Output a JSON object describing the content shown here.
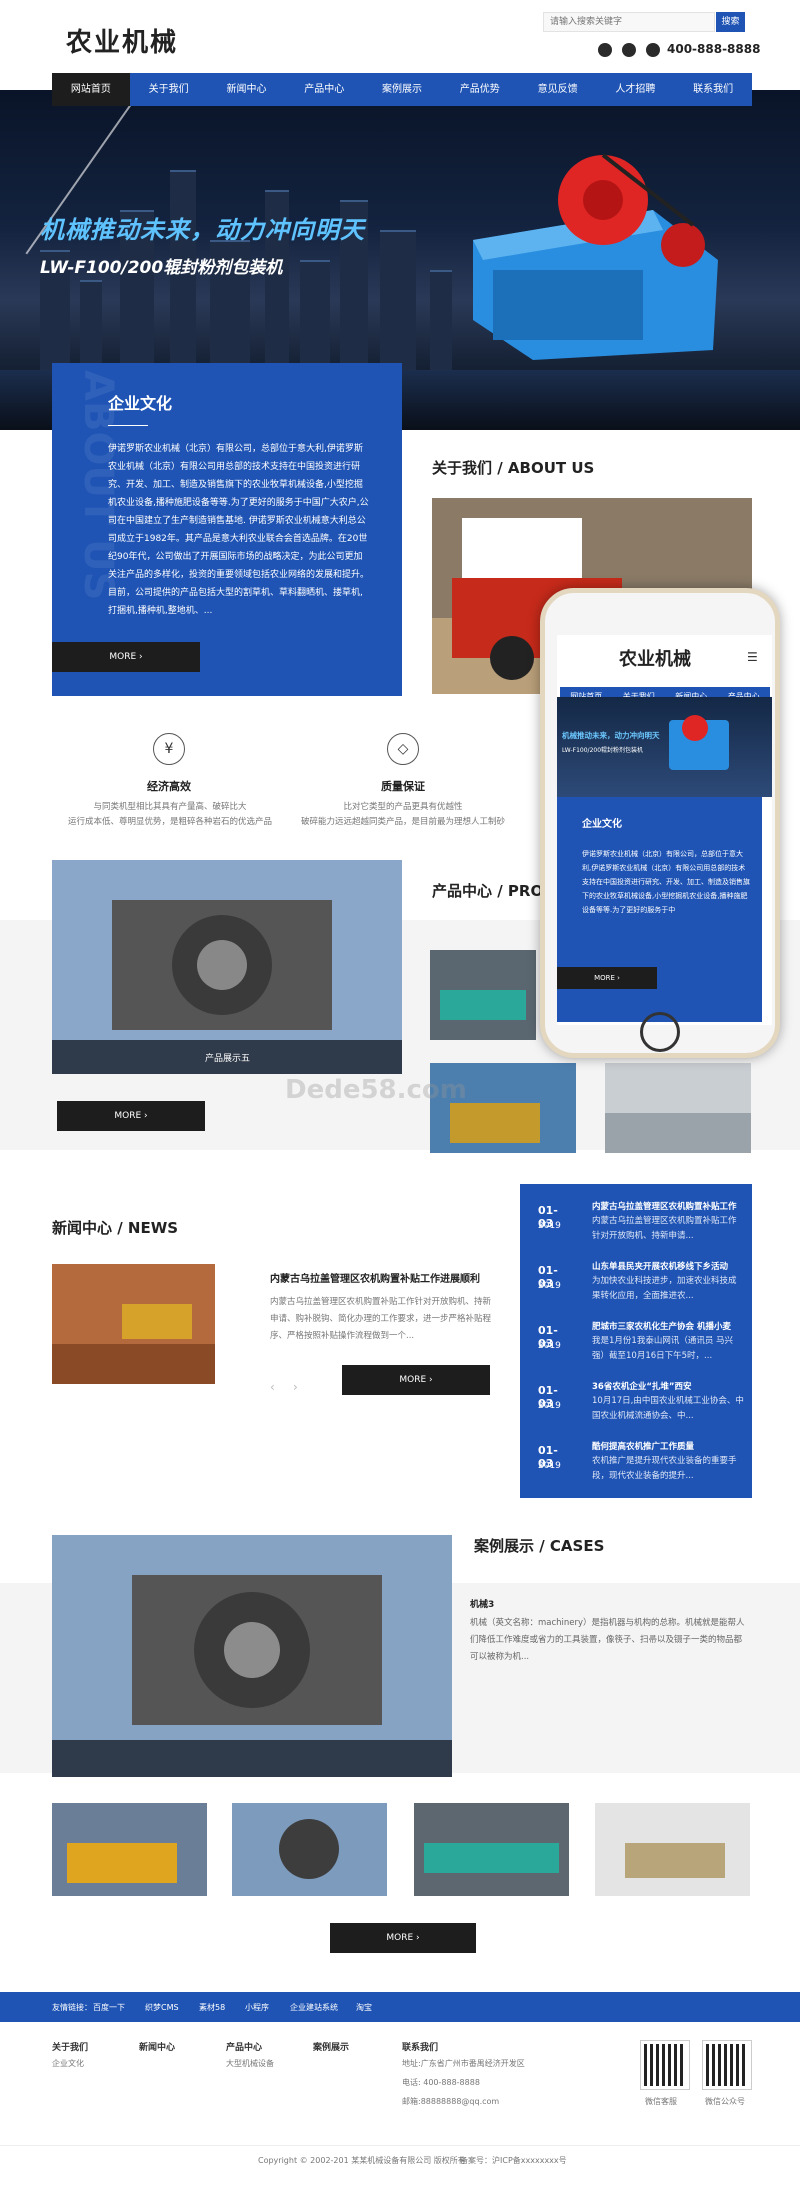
{
  "header": {
    "logo": "农业机械",
    "search_placeholder": "请输入搜索关键字",
    "search_button": "搜索",
    "phone": "400-888-8888"
  },
  "nav": [
    "网站首页",
    "关于我们",
    "新闻中心",
    "产品中心",
    "案例展示",
    "产品优势",
    "意见反馈",
    "人才招聘",
    "联系我们"
  ],
  "hero": {
    "slogan": "机械推动未来，动力冲向明天",
    "subtitle": "LW-F100/200辊封粉剂包装机"
  },
  "culture": {
    "title": "企业文化",
    "bg_text": "ABOUT US",
    "text": "伊诺罗斯农业机械（北京）有限公司，总部位于意大利,伊诺罗斯农业机械（北京）有限公司用总部的技术支持在中国投资进行研究、开发、加工、制造及销售旗下的农业牧草机械设备,小型挖掘机农业设备,播种施肥设备等等.为了更好的服务于中国广大农户,公司在中国建立了生产制造销售基地. 伊诺罗斯农业机械意大利总公司成立于1982年。其产品是意大利农业联合会首选品牌。在20世纪90年代，公司做出了开展国际市场的战略决定，为此公司更加关注产品的多样化，投资的重要领域包括农业网络的发展和提升。目前，公司提供的产品包括大型的割草机、草料翻晒机、搂草机,打捆机,播种机,整地机、...",
    "more": "MORE"
  },
  "about": {
    "title": "关于我们 / ABOUT US"
  },
  "features": [
    {
      "title": "经济高效",
      "desc": "与同类机型相比其具有产量高、破碎比大\n运行成本低、尊明显优势，是粗碎各种岩石的优选产品"
    },
    {
      "title": "质量保证",
      "desc": "比对它类型的产品更具有优越性\n破碎能力远远超越同类产品，是目前最为理想人工制砂"
    }
  ],
  "products": {
    "title": "产品中心 / PRO",
    "caption": "产品展示五",
    "more": "MORE",
    "watermark": "Dede58.com"
  },
  "phone_mock": {
    "logo": "农业机械",
    "nav": [
      "网站首页",
      "关于我们",
      "新闻中心",
      "产品中心"
    ],
    "slogan": "机械推动未来，动力冲向明天",
    "subtitle": "LW-F100/200辊封粉剂包装机",
    "culture_title": "企业文化",
    "culture_text": "伊诺罗斯农业机械（北京）有限公司，总部位于意大利,伊诺罗斯农业机械（北京）有限公司用总部的技术支持在中国投资进行研究、开发、加工、制造及销售旗下的农业牧草机械设备,小型挖掘机农业设备,播种施肥设备等等.为了更好的服务于中",
    "more": "MORE"
  },
  "news": {
    "title": "新闻中心 / NEWS",
    "feature_title": "内蒙古乌拉盖管理区农机购置补贴工作进展顺利",
    "feature_desc": "内蒙古乌拉盖管理区农机购置补贴工作针对开放购机、持新申请、购补脱钩、简化办理的工作要求，进一步严格补贴程序、严格按照补贴操作流程做到一个...",
    "more": "MORE",
    "items": [
      {
        "date": "01-03",
        "year": "2019",
        "title": "内蒙古乌拉盖管理区农机购置补贴工作",
        "desc": "内蒙古乌拉盖管理区农机购置补贴工作针对开放购机、持新申请..."
      },
      {
        "date": "01-03",
        "year": "2019",
        "title": "山东单县民夹开展农机移线下乡活动",
        "desc": "为加快农业科技进步，加速农业科技成果转化应用，全面推进农..."
      },
      {
        "date": "01-03",
        "year": "2019",
        "title": "肥城市三家农机化生产协会 机播小麦",
        "desc": "我是1月份1我泰山网讯（通讯员 马兴强）截至10月16日下午5时，..."
      },
      {
        "date": "01-03",
        "year": "2019",
        "title": "36省农机企业“扎堆”西安",
        "desc": "10月17日,由中国农业机械工业协会、中国农业机械流通协会、中..."
      },
      {
        "date": "01-03",
        "year": "2019",
        "title": "酷何提高农机推广工作质量",
        "desc": "农机推广是提升现代农业装备的重要手段，现代农业装备的提升..."
      }
    ]
  },
  "cases": {
    "title": "案例展示 / CASES",
    "item_title": "机械3",
    "item_desc": "机械（英文名称：machinery）是指机器与机构的总称。机械就是能帮人们降低工作难度或省力的工具装置，像筷子、扫帚以及镊子一类的物品都可以被称为机...",
    "more": "MORE"
  },
  "links": {
    "label": "友情链接：",
    "items": [
      "百度一下",
      "织梦CMS",
      "素材58",
      "小程序",
      "企业建站系统",
      "淘宝"
    ]
  },
  "footer": {
    "cols": [
      {
        "title": "关于我们",
        "items": [
          "企业文化"
        ]
      },
      {
        "title": "新闻中心",
        "items": []
      },
      {
        "title": "产品中心",
        "items": [
          "大型机械设备"
        ]
      },
      {
        "title": "案例展示",
        "items": []
      }
    ],
    "contact": {
      "title": "联系我们",
      "address": "地址:广东省广州市番禺经济开发区",
      "phone": "电话: 400-888-8888",
      "email": "邮箱:88888888@qq.com"
    },
    "qr": [
      "微信客服",
      "微信公众号"
    ],
    "copyright": "Copyright © 2002-201 某某机械设备有限公司 版权所有",
    "icp": "备案号：沪ICP备xxxxxxxx号"
  },
  "colors": {
    "primary": "#1f54b5",
    "dark": "#1d1d1d"
  }
}
